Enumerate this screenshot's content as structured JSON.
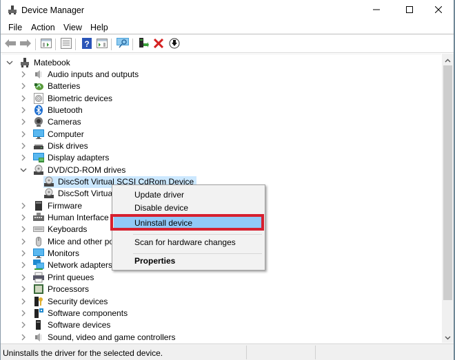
{
  "window": {
    "title": "Device Manager",
    "app_icon": "device-manager-icon",
    "controls": {
      "minimize": "minimize-icon",
      "maximize": "maximize-icon",
      "close": "close-icon"
    }
  },
  "menubar": {
    "items": [
      "File",
      "Action",
      "View",
      "Help"
    ]
  },
  "toolbar": {
    "buttons": [
      {
        "name": "back",
        "icon": "back-arrow-icon"
      },
      {
        "name": "forward",
        "icon": "forward-arrow-icon"
      },
      {
        "name": "show-hide-console-tree",
        "icon": "console-tree-icon"
      },
      {
        "name": "properties",
        "icon": "properties-icon"
      },
      {
        "name": "help",
        "icon": "help-icon"
      },
      {
        "name": "show-action-pane",
        "icon": "action-pane-icon"
      },
      {
        "name": "scan-hardware",
        "icon": "scan-monitor-icon"
      },
      {
        "name": "update-driver",
        "icon": "update-driver-icon"
      },
      {
        "name": "uninstall-device",
        "icon": "red-x-icon"
      },
      {
        "name": "disable-device",
        "icon": "down-arrow-circle-icon"
      }
    ]
  },
  "tree": {
    "root": {
      "label": "Matebook",
      "icon": "computer-tower-icon",
      "expanded": true
    },
    "categories": [
      {
        "label": "Audio inputs and outputs",
        "icon": "speaker-icon",
        "expanded": false
      },
      {
        "label": "Batteries",
        "icon": "battery-icon",
        "expanded": false
      },
      {
        "label": "Biometric devices",
        "icon": "fingerprint-icon",
        "expanded": false
      },
      {
        "label": "Bluetooth",
        "icon": "bluetooth-icon",
        "expanded": false
      },
      {
        "label": "Cameras",
        "icon": "camera-icon",
        "expanded": false
      },
      {
        "label": "Computer",
        "icon": "monitor-icon",
        "expanded": false
      },
      {
        "label": "Disk drives",
        "icon": "disk-drive-icon",
        "expanded": false
      },
      {
        "label": "Display adapters",
        "icon": "display-adapter-icon",
        "expanded": false
      },
      {
        "label": "DVD/CD-ROM drives",
        "icon": "cdrom-icon",
        "expanded": true,
        "children": [
          {
            "label": "DiscSoft Virtual SCSI CdRom Device",
            "icon": "cdrom-icon",
            "selected": true
          },
          {
            "label": "DiscSoft Virtual SCSI CdRom Device",
            "icon": "cdrom-icon",
            "selected": false
          }
        ]
      },
      {
        "label": "Firmware",
        "icon": "firmware-chip-icon",
        "expanded": false
      },
      {
        "label": "Human Interface Devices",
        "icon": "hid-icon",
        "expanded": false
      },
      {
        "label": "Keyboards",
        "icon": "keyboard-icon",
        "expanded": false
      },
      {
        "label": "Mice and other pointing devices",
        "icon": "mouse-icon",
        "expanded": false
      },
      {
        "label": "Monitors",
        "icon": "monitor-icon",
        "expanded": false
      },
      {
        "label": "Network adapters",
        "icon": "network-adapter-icon",
        "expanded": false
      },
      {
        "label": "Print queues",
        "icon": "printer-icon",
        "expanded": false
      },
      {
        "label": "Processors",
        "icon": "processor-icon",
        "expanded": false
      },
      {
        "label": "Security devices",
        "icon": "security-key-icon",
        "expanded": false
      },
      {
        "label": "Software components",
        "icon": "software-component-icon",
        "expanded": false
      },
      {
        "label": "Software devices",
        "icon": "software-device-icon",
        "expanded": false
      },
      {
        "label": "Sound, video and game controllers",
        "icon": "speaker-icon",
        "expanded": false
      }
    ]
  },
  "context_menu": {
    "items": [
      {
        "label": "Update driver",
        "bold": false,
        "highlighted": false
      },
      {
        "label": "Disable device",
        "bold": false,
        "highlighted": false
      },
      {
        "label": "Uninstall device",
        "bold": false,
        "highlighted": true
      },
      {
        "separator": true
      },
      {
        "label": "Scan for hardware changes",
        "bold": false,
        "highlighted": false
      },
      {
        "separator": true
      },
      {
        "label": "Properties",
        "bold": true,
        "highlighted": false
      }
    ],
    "annotation_color": "#d6202f"
  },
  "statusbar": {
    "text": "Uninstalls the driver for the selected device."
  },
  "colors": {
    "selection": "#cce8ff",
    "menu_highlight": "#91c9f7",
    "annotation": "#d6202f"
  }
}
